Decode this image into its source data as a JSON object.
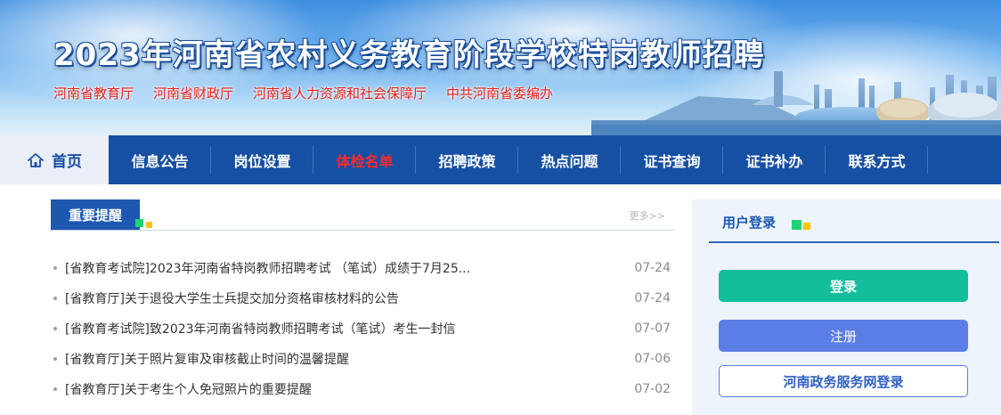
{
  "banner": {
    "title": "2023年河南省农村义务教育阶段学校特岗教师招聘",
    "orgs": [
      "河南省教育厅",
      "河南省财政厅",
      "河南省人力资源和社会保障厅",
      "中共河南省委编办"
    ]
  },
  "nav": {
    "home_label": "首页",
    "home_icon": "home-icon",
    "items": [
      {
        "label": "信息公告"
      },
      {
        "label": "岗位设置"
      },
      {
        "label": "体检名单",
        "highlight": true
      },
      {
        "label": "招聘政策"
      },
      {
        "label": "热点问题"
      },
      {
        "label": "证书查询"
      },
      {
        "label": "证书补办"
      },
      {
        "label": "联系方式"
      }
    ],
    "colors": {
      "bar": "#1650a3",
      "home_bg": "#e9eef7",
      "highlight": "#ff2a2a"
    }
  },
  "notice": {
    "title": "重要提醒",
    "more": "更多>>",
    "items": [
      {
        "text": "[省教育考试院]2023年河南省特岗教师招聘考试 （笔试）成绩于7月25...",
        "date": "07-24"
      },
      {
        "text": "[省教育厅]关于退役大学生士兵提交加分资格审核材料的公告",
        "date": "07-24"
      },
      {
        "text": "[省教育考试院]致2023年河南省特岗教师招聘考试（笔试）考生一封信",
        "date": "07-07"
      },
      {
        "text": "[省教育厅]关于照片复审及审核截止时间的温馨提醒",
        "date": "07-06"
      },
      {
        "text": "[省教育厅]关于考生个人免冠照片的重要提醒",
        "date": "07-02"
      }
    ]
  },
  "login": {
    "title": "用户登录",
    "login_button": "登录",
    "register_button": "注册",
    "gov_login_button": "河南政务服务网登录",
    "colors": {
      "login": "#13be9d",
      "register": "#5b7ee6",
      "accent_green": "#1fd37a",
      "accent_yellow": "#ffc20e"
    }
  }
}
